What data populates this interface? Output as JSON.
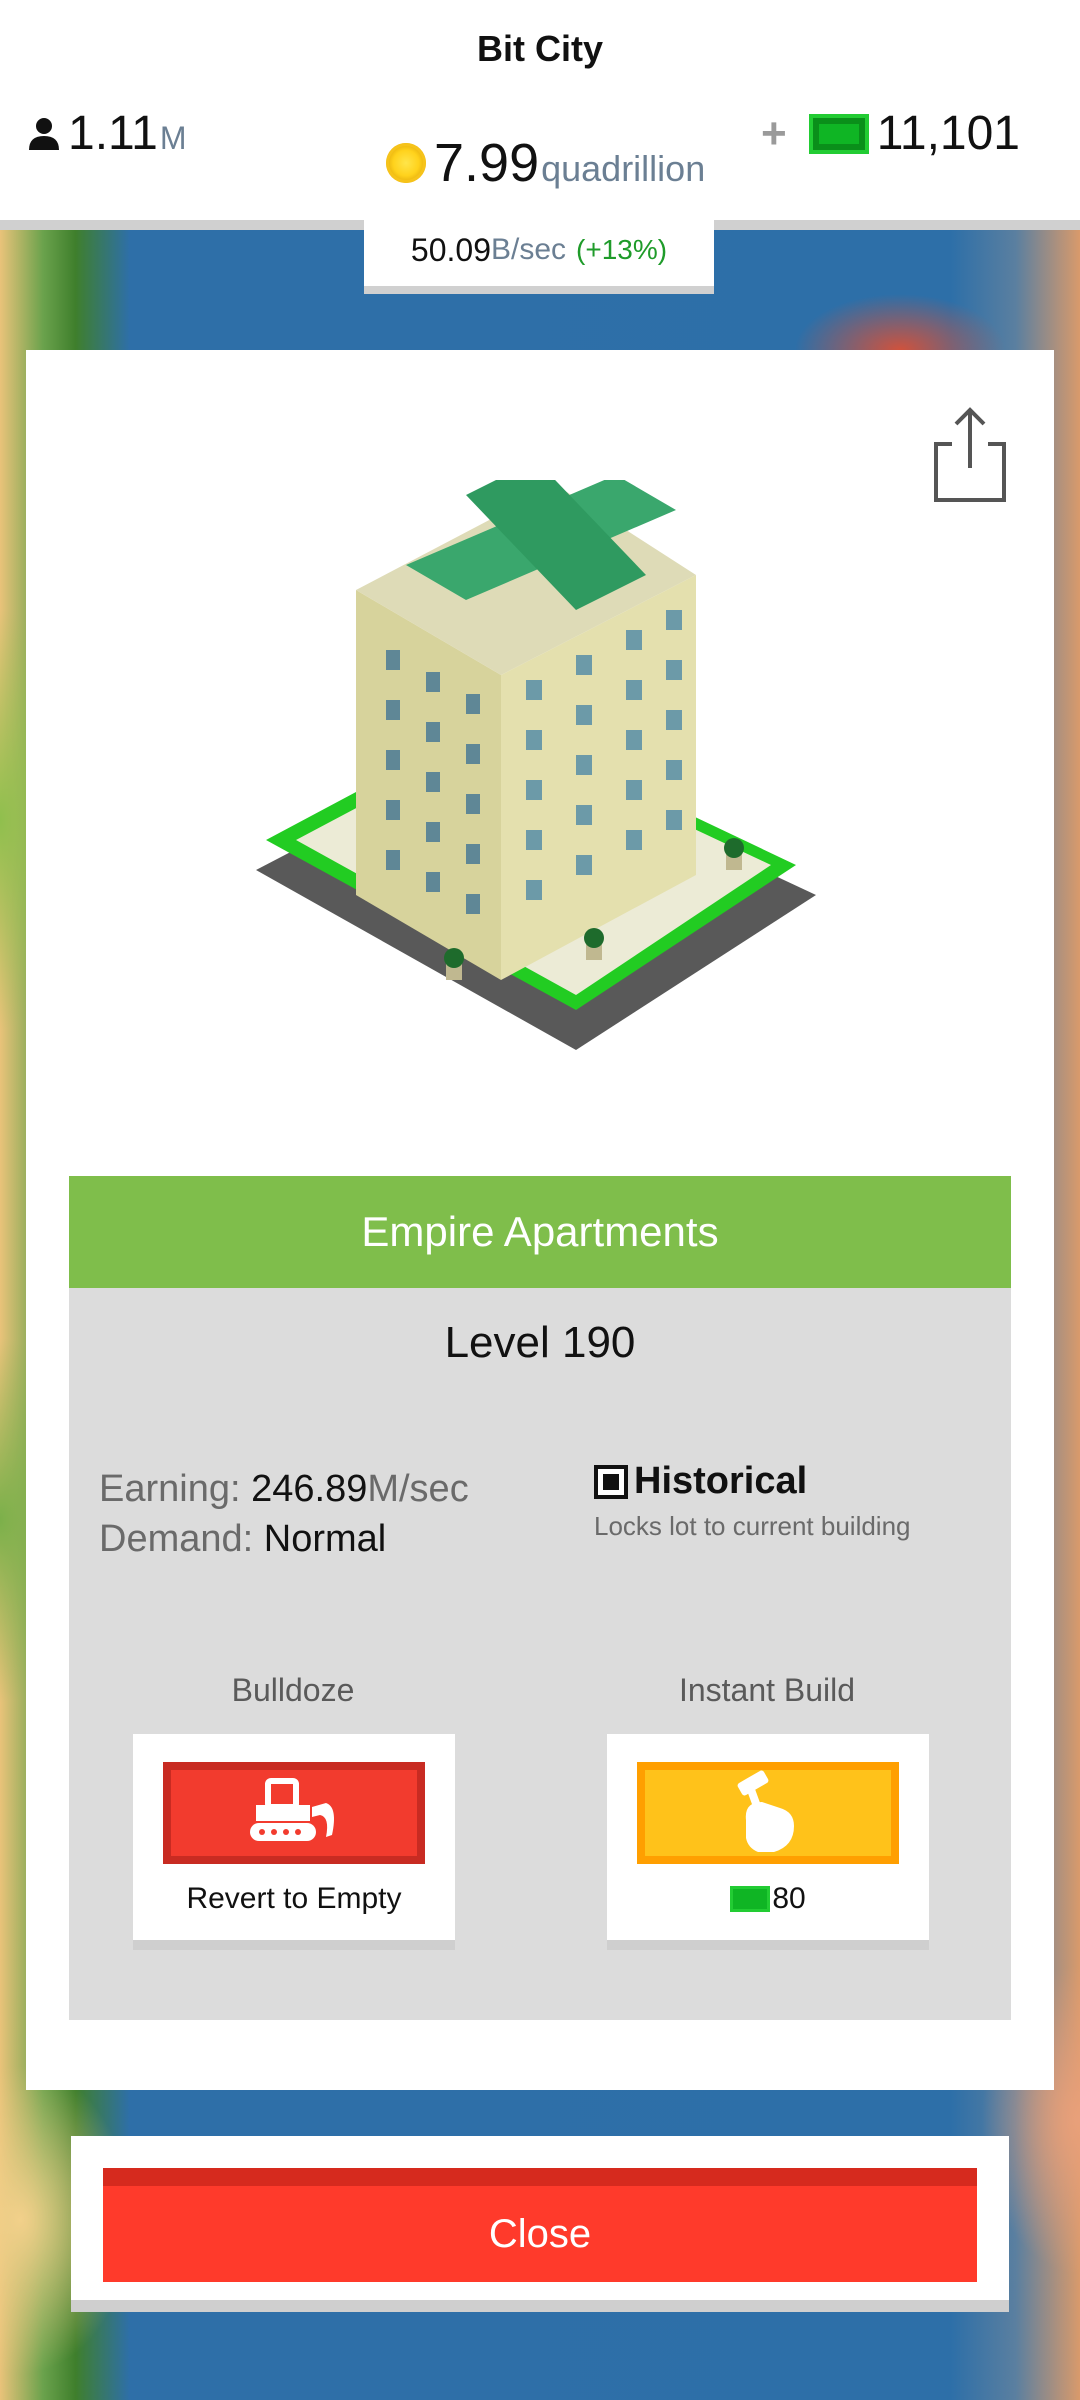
{
  "hud": {
    "title": "Bit City",
    "population": {
      "value": "1.11",
      "unit": "M"
    },
    "money": {
      "value": "7.99",
      "unit": "quadrillion"
    },
    "bucks": {
      "plus": "+",
      "value": "11,101"
    },
    "rate": {
      "value": "50.09",
      "unit": "B/sec",
      "percent": "(+13%)"
    }
  },
  "building": {
    "name": "Empire Apartments",
    "level": "Level 190",
    "earning_label": "Earning:",
    "earning_value": "246.89",
    "earning_unit": "M/sec",
    "demand_label": "Demand:",
    "demand_value": "Normal",
    "historical_label": "Historical",
    "historical_sub": "Locks lot to current building"
  },
  "actions": {
    "bulldoze_label": "Bulldoze",
    "bulldoze_text": "Revert to Empty",
    "instant_label": "Instant Build",
    "instant_cost": "80"
  },
  "close_label": "Close",
  "icons": {
    "population": "person-icon",
    "money": "coin-icon",
    "bucks": "green-bill-icon",
    "share": "share-icon",
    "bulldoze": "bulldozer-icon",
    "instant": "hammer-hand-icon"
  },
  "colors": {
    "name_bar": "#7fbe4b",
    "close": "#ff3a2b",
    "bulldoze": "#f23b2e",
    "instant": "#ffc21a"
  }
}
